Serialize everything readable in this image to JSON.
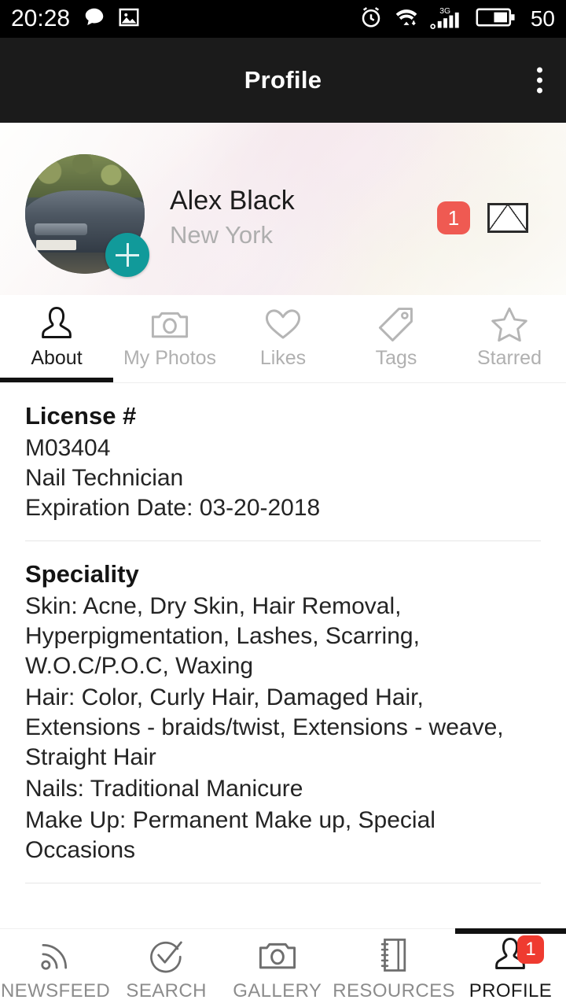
{
  "status_bar": {
    "time": "20:28",
    "left_icons": [
      "chat-bubble-icon",
      "image-icon"
    ],
    "right_icons": [
      "alarm-icon",
      "wifi-icon",
      "signal-3g-icon"
    ],
    "network_label": "3G",
    "battery_percent": "50"
  },
  "app_bar": {
    "title": "Profile",
    "overflow_label": "more-options"
  },
  "profile": {
    "name": "Alex Black",
    "location": "New York",
    "avatar_alt": "profile-photo",
    "add_photo_label": "+",
    "message_badge_count": "1",
    "message_icon": "envelope-icon"
  },
  "tabs": [
    {
      "label": "About",
      "icon": "person-icon",
      "active": true
    },
    {
      "label": "My Photos",
      "icon": "camera-icon",
      "active": false
    },
    {
      "label": "Likes",
      "icon": "heart-icon",
      "active": false
    },
    {
      "label": "Tags",
      "icon": "tag-icon",
      "active": false
    },
    {
      "label": "Starred",
      "icon": "star-icon",
      "active": false
    }
  ],
  "about": {
    "license": {
      "title": "License #",
      "number": "M03404",
      "profession": "Nail Technician",
      "expiration": "Expiration Date: 03-20-2018"
    },
    "speciality": {
      "title": "Speciality",
      "skin": "Skin: Acne, Dry Skin, Hair Removal, Hyperpigmentation, Lashes, Scarring, W.O.C/P.O.C, Waxing",
      "hair": "Hair: Color, Curly Hair, Damaged Hair, Extensions - braids/twist, Extensions - weave, Straight Hair",
      "nails": "Nails: Traditional Manicure",
      "makeup": "Make Up: Permanent Make up, Special Occasions"
    }
  },
  "bottom_nav": [
    {
      "label": "NEWSFEED",
      "icon": "rss-icon",
      "active": false,
      "badge": ""
    },
    {
      "label": "SEARCH",
      "icon": "check-circle-icon",
      "active": false,
      "badge": ""
    },
    {
      "label": "GALLERY",
      "icon": "camera-icon",
      "active": false,
      "badge": ""
    },
    {
      "label": "RESOURCES",
      "icon": "notebook-icon",
      "active": false,
      "badge": ""
    },
    {
      "label": "PROFILE",
      "icon": "person-icon",
      "active": true,
      "badge": "1"
    }
  ],
  "colors": {
    "accent_teal": "#119a9a",
    "badge_red": "#ef5a52",
    "nav_badge_red": "#ef3b30",
    "appbar_bg": "#1b1b1b",
    "statusbar_bg": "#000000"
  }
}
